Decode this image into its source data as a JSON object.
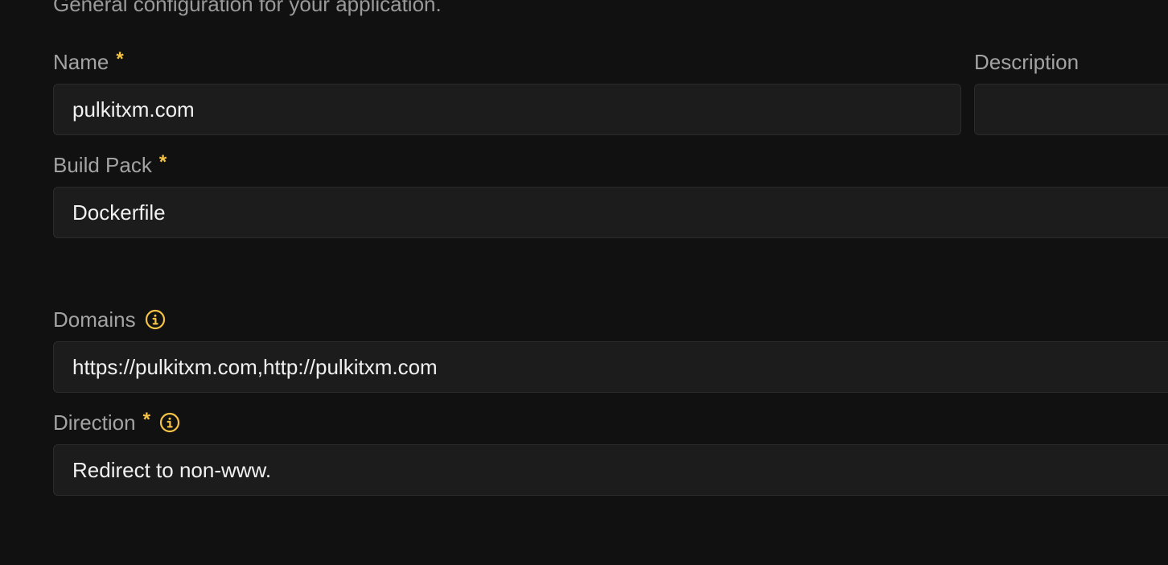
{
  "section": {
    "subtitle": "General configuration for your application."
  },
  "form": {
    "name": {
      "label": "Name",
      "required_mark": "*",
      "value": "pulkitxm.com"
    },
    "description": {
      "label": "Description",
      "value": ""
    },
    "build_pack": {
      "label": "Build Pack",
      "required_mark": "*",
      "value": "Dockerfile"
    },
    "domains": {
      "label": "Domains",
      "value": "https://pulkitxm.com,http://pulkitxm.com",
      "icon": "info-icon"
    },
    "direction": {
      "label": "Direction",
      "required_mark": "*",
      "value": "Redirect to non-www.",
      "icon": "info-icon"
    }
  },
  "colors": {
    "background": "#111111",
    "field_background": "#1c1c1c",
    "field_border": "#2b2b2b",
    "label": "#a3a3a3",
    "accent": "#f6c445"
  }
}
